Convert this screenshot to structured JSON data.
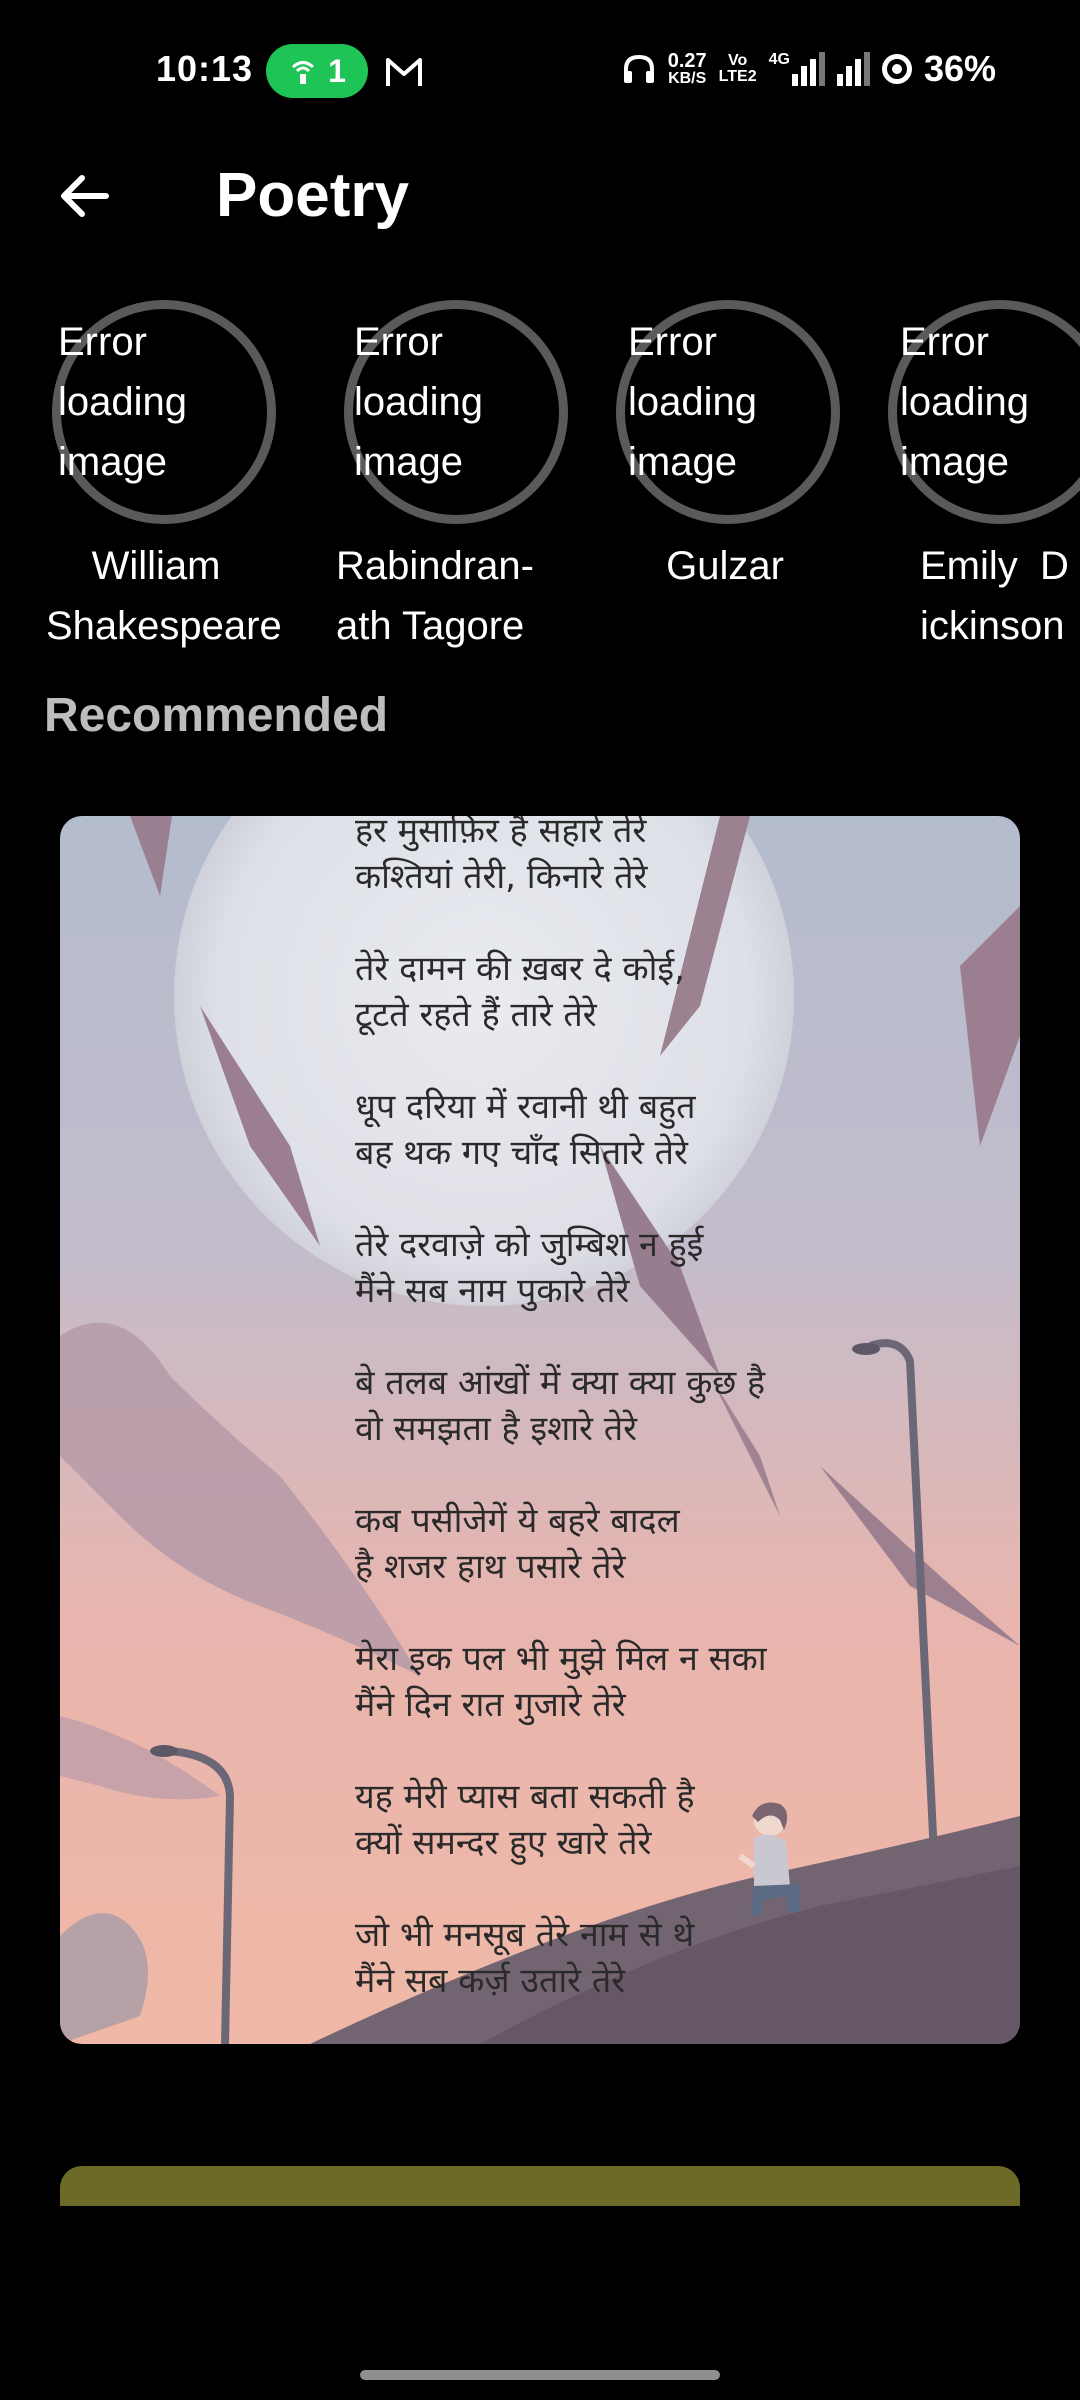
{
  "status_bar": {
    "time": "10:13",
    "hotspot_count": "1",
    "net_speed_value": "0.27",
    "net_speed_unit": "KB/S",
    "volte_top": "Vo",
    "volte_bottom": "LTE2",
    "network_type": "4G",
    "battery": "36%"
  },
  "app_bar": {
    "title": "Poetry"
  },
  "poets": [
    {
      "error": "Error\nloading\nimage",
      "name": "William\nShakespeare"
    },
    {
      "error": "Error\nloading\nimage",
      "name": "Rabindran-\nath Tagore"
    },
    {
      "error": "Error\nloading\nimage",
      "name": "Gulzar"
    },
    {
      "error": "Error\nloading\nimage",
      "name": "Emily  D\nickinson"
    }
  ],
  "section": {
    "title": "Recommended"
  },
  "poem": {
    "stanzas": [
      [
        "हर मुसाफ़िर है सहारे तेरे",
        "कश्तियां तेरी, किनारे तेरे"
      ],
      [
        "तेरे दामन की ख़बर दे कोई,",
        "टूटते रहते हैं तारे तेरे"
      ],
      [
        "धूप दरिया में रवानी थी बहुत",
        "बह थक गए चाँद सितारे तेरे"
      ],
      [
        "तेरे दरवाज़े को जुम्बिश न हुई",
        "मैंने सब नाम पुकारे तेरे"
      ],
      [
        "बे तलब आंखों में क्या क्या कुछ है",
        "वो समझता है इशारे तेरे"
      ],
      [
        "कब पसीजेगें ये बहरे बादल",
        "है शजर हाथ पसारे तेरे"
      ],
      [
        "मेरा इक पल भी मुझे मिल न सका",
        "मैंने दिन रात गुजारे तेरे"
      ],
      [
        "यह मेरी प्यास बता सकती है",
        "क्यों समन्दर हुए खारे तेरे"
      ],
      [
        "जो भी मनसूब तेरे नाम से थे",
        "मैंने सब कर्ज़ उतारे तेरे"
      ]
    ]
  },
  "colors": {
    "background": "#000000",
    "hotspot_pill": "#1ec455",
    "section_title": "#bdbdbd",
    "next_card": "#6b6a27"
  }
}
